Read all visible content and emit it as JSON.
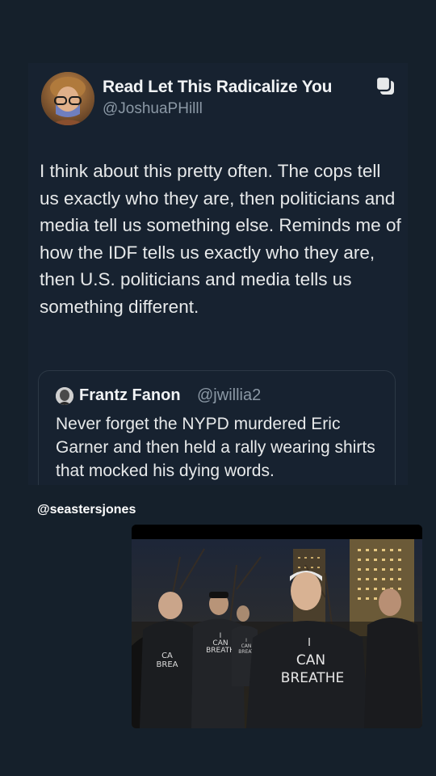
{
  "tweet": {
    "author_name": "Read Let This Radicalize You",
    "author_handle": "@JoshuaPHilll",
    "text": "I think about this pretty often. The cops tell us exactly who they are, then politicians and media tell us something else. Reminds me of how the IDF tells us exactly who they are, then U.S. politicians and media tells us something different.",
    "icons": {
      "avatar": "avatar-photo",
      "corner": "copy-icon"
    }
  },
  "quote": {
    "author_name": "Frantz Fanon",
    "author_handle": "@jwillia2",
    "text": "Never forget the NYPD murdered Eric Garner and then held a rally wearing shirts that mocked his dying words."
  },
  "caption": "@seastersjones",
  "photo": {
    "shirt_text_center": [
      "I",
      "CAN",
      "BREATHE"
    ],
    "shirt_text_left": [
      "CA",
      "BREA"
    ],
    "shirt_text_mid": [
      "I",
      "CAN",
      "BREATH"
    ],
    "shirt_text_small": [
      "I",
      "CAN",
      "BREAT"
    ]
  },
  "colors": {
    "background": "#15202b",
    "card": "#172230",
    "text": "#e7e9ea",
    "muted": "#8b98a5",
    "border": "#2c3845"
  }
}
